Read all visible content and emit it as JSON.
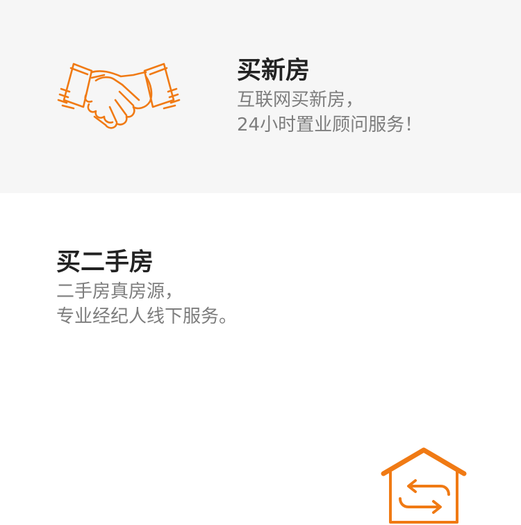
{
  "colors": {
    "accent": "#f07a14",
    "title": "#222222",
    "text": "#7d7d7d",
    "panel_bg": "#f6f6f6"
  },
  "new_house": {
    "icon": "handshake-icon",
    "title": "买新房",
    "line1": "互联网买新房，",
    "line2": "24小时置业顾问服务！"
  },
  "used_house": {
    "icon": "house-exchange-icon",
    "title": "买二手房",
    "line1": "二手房真房源，",
    "line2": "专业经纪人线下服务。"
  }
}
